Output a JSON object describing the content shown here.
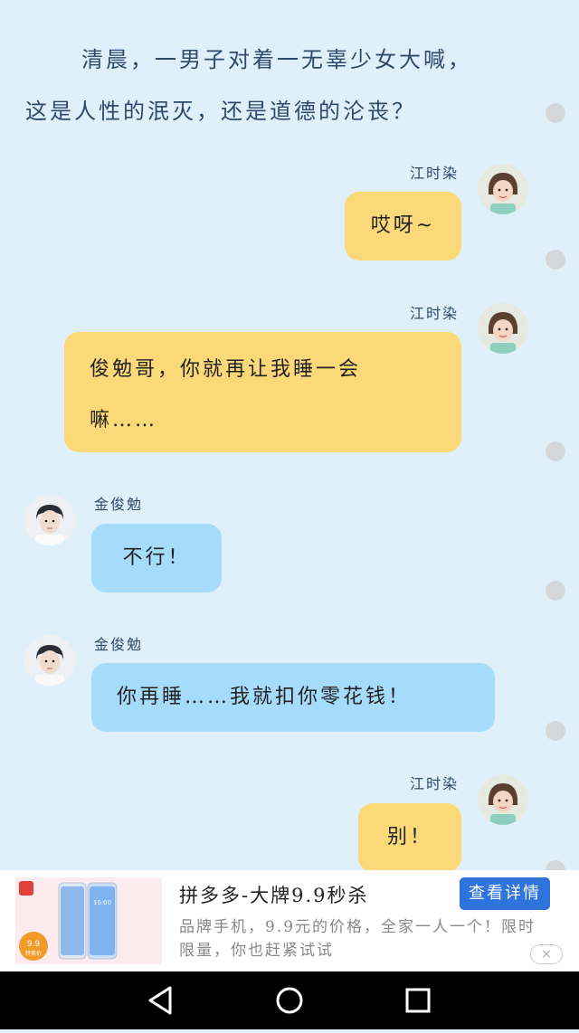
{
  "intro": {
    "line1": "清晨，一男子对着一无辜少女大喊，",
    "line2": "这是人性的泯灭，还是道德的沦丧？"
  },
  "messages": [
    {
      "sender": "江时染",
      "text": "哎呀~",
      "side": "right"
    },
    {
      "sender": "江时染",
      "text": "俊勉哥，你就再让我睡一会嘛……",
      "side": "right"
    },
    {
      "sender": "金俊勉",
      "text": "不行！",
      "side": "left"
    },
    {
      "sender": "金俊勉",
      "text": "你再睡……我就扣你零花钱！",
      "side": "left"
    },
    {
      "sender": "江时染",
      "text": "别！",
      "side": "right"
    }
  ],
  "ad": {
    "title": "拼多多-大牌9.9秒杀",
    "button": "查看详情",
    "description": "品牌手机，9.9元的价格，全家一人一个！限时限量，你也赶紧试试",
    "badge": "9.9",
    "badge_sub": "特卖价",
    "phone_time": "10:00",
    "close_icon": "×"
  },
  "nav": {
    "back_icon": "triangle-back",
    "home_icon": "circle-home",
    "recents_icon": "square-recents"
  },
  "colors": {
    "background": "#dff0fb",
    "yellow_bubble": "#fcd978",
    "blue_bubble": "#a6dcfb",
    "ad_button": "#2f73dd"
  }
}
